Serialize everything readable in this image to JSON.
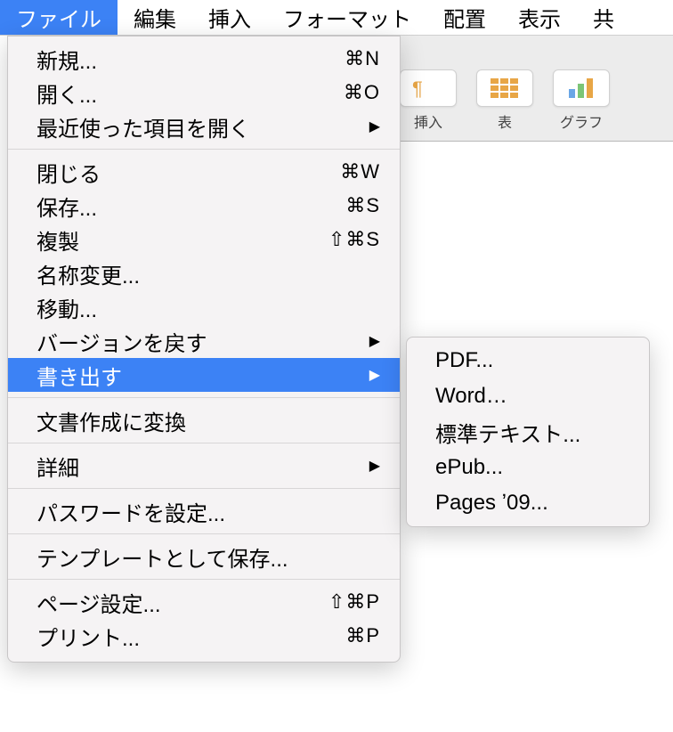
{
  "menubar": {
    "items": [
      "ファイル",
      "編集",
      "挿入",
      "フォーマット",
      "配置",
      "表示",
      "共"
    ]
  },
  "toolbar": {
    "items": [
      {
        "label": "挿入",
        "icon": "insert"
      },
      {
        "label": "表",
        "icon": "table"
      },
      {
        "label": "グラフ",
        "icon": "chart"
      }
    ]
  },
  "file_menu": {
    "groups": [
      [
        {
          "label": "新規...",
          "shortcut": "⌘N"
        },
        {
          "label": "開く...",
          "shortcut": "⌘O"
        },
        {
          "label": "最近使った項目を開く",
          "submenu": true
        }
      ],
      [
        {
          "label": "閉じる",
          "shortcut": "⌘W"
        },
        {
          "label": "保存...",
          "shortcut": "⌘S"
        },
        {
          "label": "複製",
          "shortcut": "⇧⌘S"
        },
        {
          "label": "名称変更..."
        },
        {
          "label": "移動..."
        },
        {
          "label": "バージョンを戻す",
          "submenu": true
        },
        {
          "label": "書き出す",
          "submenu": true,
          "highlight": true
        }
      ],
      [
        {
          "label": "文書作成に変換"
        }
      ],
      [
        {
          "label": "詳細",
          "submenu": true
        }
      ],
      [
        {
          "label": "パスワードを設定..."
        }
      ],
      [
        {
          "label": "テンプレートとして保存..."
        }
      ],
      [
        {
          "label": "ページ設定...",
          "shortcut": "⇧⌘P"
        },
        {
          "label": "プリント...",
          "shortcut": "⌘P"
        }
      ]
    ]
  },
  "export_submenu": {
    "items": [
      "PDF...",
      "Word…",
      "標準テキスト...",
      "ePub...",
      "Pages ʼ09..."
    ]
  }
}
